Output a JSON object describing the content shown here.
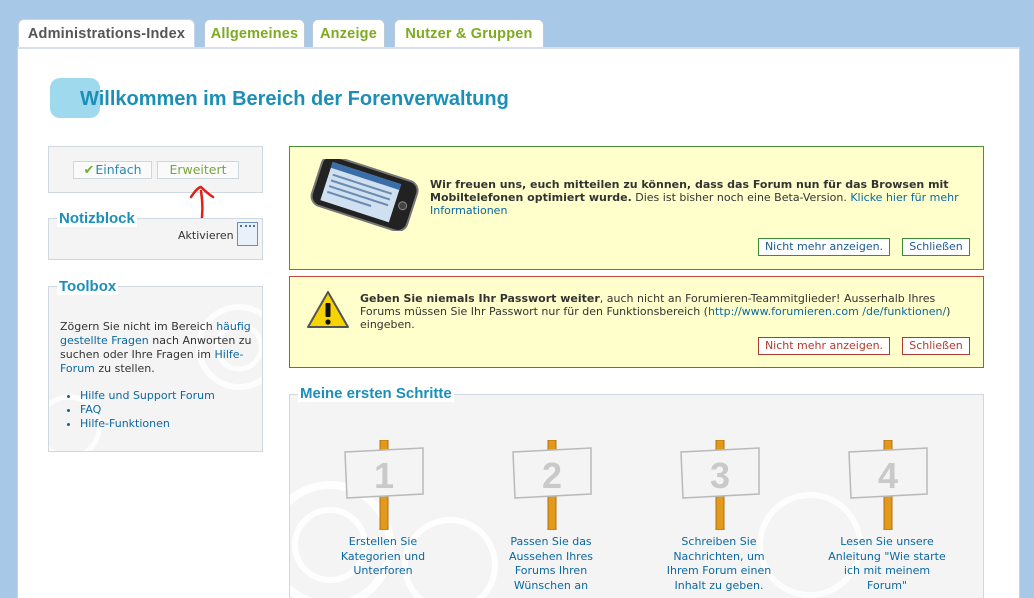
{
  "tabs": [
    {
      "label": "Administrations-Index",
      "active": true
    },
    {
      "label": "Allgemeines",
      "active": false
    },
    {
      "label": "Anzeige",
      "active": false
    },
    {
      "label": "Nutzer & Gruppen",
      "active": false
    }
  ],
  "welcome_title": "Willkommen im Bereich der Forenverwaltung",
  "mode": {
    "einfach": "Einfach",
    "erweitert": "Erweitert"
  },
  "notizblock": {
    "title": "Notizblock",
    "activate": "Aktivieren"
  },
  "toolbox": {
    "title": "Toolbox",
    "text_1": "Zögern Sie nicht im Bereich",
    "link_faq": "häufig gestellte Fragen",
    "text_2": " nach Anworten zu suchen oder Ihre Fragen im ",
    "link_forum": "Hilfe-Forum",
    "text_3": " zu stellen.",
    "links": [
      "Hilfe und Support Forum",
      "FAQ",
      "Hilfe-Funktionen"
    ]
  },
  "mobile_notice": {
    "bold": "Wir freuen uns, euch mitteilen zu können, dass das Forum nun für das Browsen mit Mobiltelefonen optimiert wurde.",
    "text": " Dies ist bisher noch eine Beta-Version. ",
    "link": "Klicke hier für mehr Informationen",
    "btn_hide": "Nicht mehr anzeigen.",
    "btn_close": "Schließen"
  },
  "password_notice": {
    "bold": "Geben Sie niemals Ihr Passwort weiter",
    "text": ", auch nicht an Forumieren-Teammitglieder! Ausserhalb Ihres Forums müssen Sie Ihr Passwort nur für den Funktionsbereich (",
    "link": "http://www.forumieren.com /de/funktionen/",
    "text_end": ") eingeben.",
    "btn_hide": "Nicht mehr anzeigen.",
    "btn_close": "Schließen"
  },
  "first_steps": {
    "title": "Meine ersten Schritte",
    "steps": [
      {
        "number": "1",
        "label": "Erstellen Sie Kategorien und Unterforen"
      },
      {
        "number": "2",
        "label": "Passen Sie das Aussehen Ihres Forums Ihren Wünschen an"
      },
      {
        "number": "3",
        "label": "Schreiben Sie Nachrichten, um Ihrem Forum einen Inhalt zu geben."
      },
      {
        "number": "4",
        "label": "Lesen Sie unsere Anleitung \"Wie starte ich mit meinem Forum\""
      }
    ]
  },
  "colors": {
    "accent": "#1c8fb8",
    "tab_green": "#7cab1f",
    "link": "#0b68a0",
    "notice_bg": "#ffffcc"
  }
}
